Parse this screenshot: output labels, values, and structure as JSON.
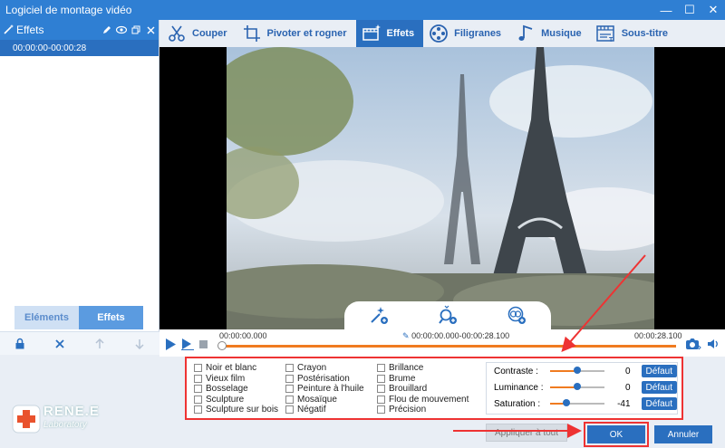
{
  "window": {
    "title": "Logiciel de montage vidéo",
    "min": "—",
    "max": "☐",
    "close": "✕"
  },
  "left_panel": {
    "header": "Effets",
    "clip": "00:00:00-00:00:28",
    "tabs": [
      "Eléments",
      "Effets"
    ],
    "tools": [
      "lock",
      "delete",
      "move-up",
      "move-down"
    ]
  },
  "tabs": [
    {
      "label": "Couper",
      "icon": "cut-icon"
    },
    {
      "label": "Pivoter et rogner",
      "icon": "crop-icon"
    },
    {
      "label": "Effets",
      "icon": "effects-icon",
      "active": true
    },
    {
      "label": "Filigranes",
      "icon": "film-icon"
    },
    {
      "label": "Musique",
      "icon": "music-icon"
    },
    {
      "label": "Sous-titre",
      "icon": "subtitle-icon"
    }
  ],
  "timeline": {
    "start": "00:00:00.000",
    "range": "00:00:00.000-00:00:28.100",
    "end": "00:00:28.100"
  },
  "filters": [
    "Noir et blanc",
    "Crayon",
    "Brillance",
    "Vieux film",
    "Postérisation",
    "Brume",
    "Bosselage",
    "Peinture à l'huile",
    "Brouillard",
    "Sculpture",
    "Mosaïque",
    "Flou de mouvement",
    "Sculpture sur bois",
    "Négatif",
    "Précision"
  ],
  "adjustments": [
    {
      "label": "Contraste :",
      "value": "0",
      "fraction": 0.5,
      "button": "Défaut"
    },
    {
      "label": "Luminance :",
      "value": "0",
      "fraction": 0.5,
      "button": "Défaut"
    },
    {
      "label": "Saturation :",
      "value": "-41",
      "fraction": 0.3,
      "button": "Défaut"
    }
  ],
  "buttons": {
    "apply_all": "Appliquer à tout",
    "ok": "OK",
    "cancel": "Annuler"
  },
  "logo": {
    "name": "RENE.E",
    "sub": "Laboratory"
  },
  "colors": {
    "primary": "#2a6fbf",
    "accent": "#f07b20",
    "highlight": "#e33333"
  }
}
